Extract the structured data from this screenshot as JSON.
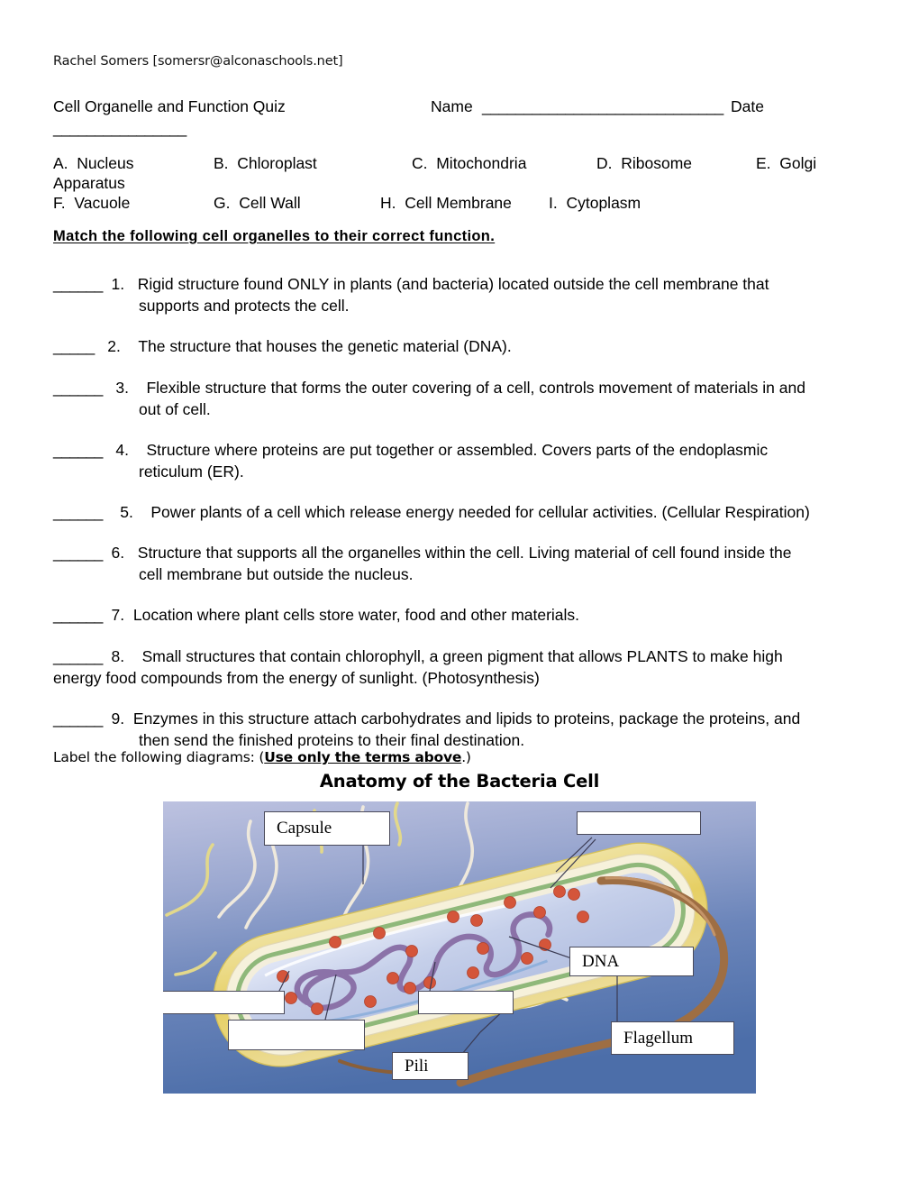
{
  "header": {
    "author_email": "Rachel Somers [somersr@alconaschools.net]"
  },
  "title_line": {
    "quiz_title": "Cell Organelle and Function Quiz",
    "name_label": "Name",
    "name_blank": "_____________________________",
    "date_label": "Date",
    "date_blank": "________________"
  },
  "options": [
    {
      "letter": "A.",
      "text": "Nucleus"
    },
    {
      "letter": "B.",
      "text": "Chloroplast"
    },
    {
      "letter": "C.",
      "text": "Mitochondria"
    },
    {
      "letter": "D.",
      "text": "Ribosome"
    },
    {
      "letter": "E.",
      "text": "Golgi"
    },
    {
      "letter": "",
      "text": "Apparatus"
    },
    {
      "letter": "F.",
      "text": "Vacuole"
    },
    {
      "letter": "G.",
      "text": "Cell Wall"
    },
    {
      "letter": "H.",
      "text": "Cell Membrane"
    },
    {
      "letter": "I.",
      "text": "Cytoplasm"
    }
  ],
  "match_heading": "Match the following cell organelles to their correct function.",
  "questions": [
    {
      "blank": "______",
      "number": "1.",
      "text": "Rigid structure found ONLY in plants (and bacteria) located outside the cell membrane that supports and protects the cell."
    },
    {
      "blank": "_____",
      "number": "2.",
      "text": "The structure that houses the genetic material (DNA)."
    },
    {
      "blank": "______",
      "number": "3.",
      "text": "Flexible structure that forms the outer covering of a cell, controls movement of materials in and out of cell."
    },
    {
      "blank": "______",
      "number": "4.",
      "text": "Structure where proteins are put together or assembled.  Covers parts of the endoplasmic reticulum (ER)."
    },
    {
      "blank": "______",
      "number": "5.",
      "text": "Power plants of a cell which release energy needed for cellular activities. (Cellular Respiration)"
    },
    {
      "blank": "______",
      "number": "6.",
      "text": "Structure that supports all the organelles within the cell.  Living material of cell found inside the cell membrane but outside the nucleus."
    },
    {
      "blank": "______",
      "number": "7.",
      "text": "Location where plant cells store water, food and other materials."
    },
    {
      "blank": "______",
      "number": "8.",
      "text": "Small structures that contain chlorophyll, a green pigment that allows PLANTS to make high energy food compounds from the energy of sunlight. (Photosynthesis)"
    },
    {
      "blank": "______",
      "number": "9.",
      "text": "Enzymes in this structure attach carbohydrates and lipids to proteins, package the proteins, and then send the finished proteins to their final destination."
    }
  ],
  "label_instruction": {
    "prefix": "Label the following diagrams:  (",
    "emphasis": "Use only the terms above",
    "suffix": ".)"
  },
  "diagram": {
    "title": "Anatomy of the Bacteria Cell",
    "labels": [
      {
        "id": "capsule",
        "text": "Capsule"
      },
      {
        "id": "top-right-blank",
        "text": ""
      },
      {
        "id": "dna",
        "text": "DNA"
      },
      {
        "id": "flagellum",
        "text": "Flagellum"
      },
      {
        "id": "left-blank",
        "text": ""
      },
      {
        "id": "lower-left-blank",
        "text": ""
      },
      {
        "id": "middle-blank",
        "text": ""
      },
      {
        "id": "pili",
        "text": "Pili"
      }
    ],
    "colors": {
      "background_top": "#b9bedd",
      "background_bottom": "#4a6ca8",
      "capsule_yellow": "#e9d46f",
      "capsule_pale": "#f4eed3",
      "wall_green": "#8fb87a",
      "cytoplasm": "#c4cee9",
      "dna_purple": "#8b72a8",
      "ribosome": "#d4553a",
      "flagellum_brown": "#9e6e43",
      "pili_cream": "#efe9dc"
    }
  }
}
